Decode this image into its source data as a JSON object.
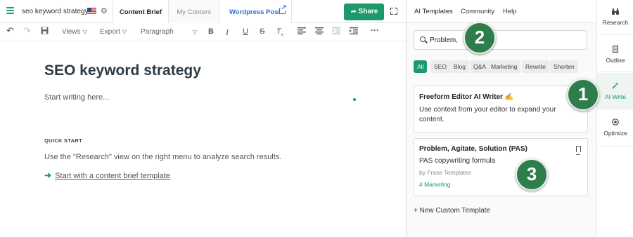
{
  "header": {
    "doc_title": "seo keyword strategy",
    "tabs": [
      "Content Brief",
      "My Content",
      "Wordpress Post"
    ],
    "share_label": "Share"
  },
  "toolbar": {
    "views_label": "Views",
    "export_label": "Export",
    "paragraph_label": "Paragraph"
  },
  "editor": {
    "heading": "SEO keyword strategy",
    "placeholder": "Start writing here...",
    "quick_start_label": "QUICK START",
    "quick_start_text": "Use the \"Research\" view on the right menu to analyze search results.",
    "quick_start_link": "Start with a content brief template"
  },
  "panel": {
    "tabs": [
      "AI Templates",
      "Community",
      "Help"
    ],
    "search_value": "Problem,",
    "filters": [
      "All",
      "SEO",
      "Blog",
      "Q&A",
      "Marketing",
      "Rewrite",
      "Shorten"
    ],
    "cards": [
      {
        "title": "Freeform Editor AI Writer ✍️",
        "text": "Use context from your editor to expand your content."
      },
      {
        "title": "Problem, Agitate, Solution (PAS)",
        "text": "PAS copywriting formula",
        "author": "by Frase Templates",
        "tag": "# Marketing"
      }
    ],
    "new_template_label": "+ New Custom Template"
  },
  "sidenav": {
    "items": [
      "Research",
      "Outline",
      "AI Write",
      "Optimize"
    ],
    "active": "AI Write"
  },
  "annotations": [
    "1",
    "2",
    "3"
  ],
  "colors": {
    "accent": "#1d9a6c",
    "link_blue": "#2f6fd6",
    "badge_green": "#2f7d4c"
  }
}
